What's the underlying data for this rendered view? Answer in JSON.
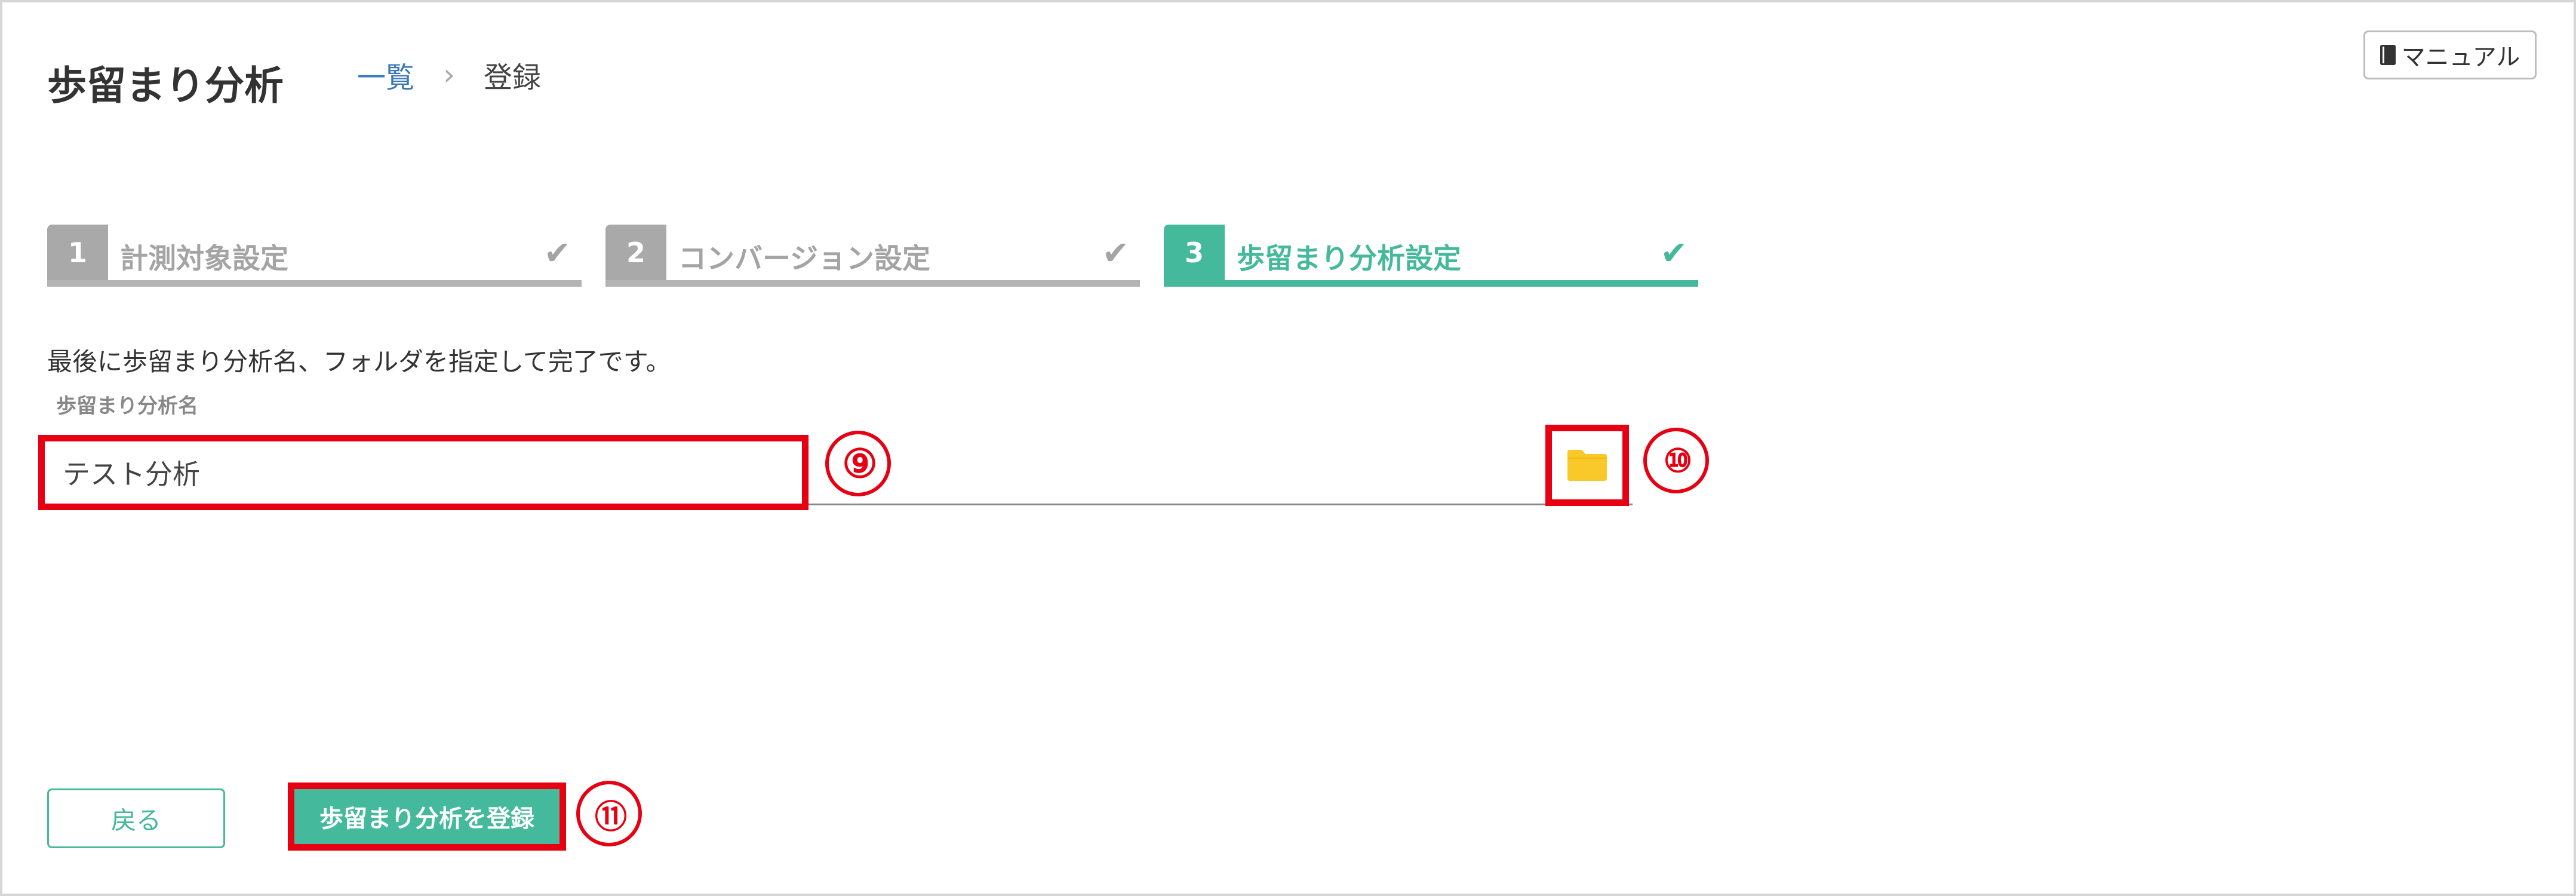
{
  "header": {
    "title": "歩留まり分析",
    "breadcrumb": {
      "link": "一覧",
      "separator": "›",
      "current": "登録"
    },
    "manual_button": {
      "label": "マニュアル",
      "icon": "book-icon"
    }
  },
  "stepper": {
    "steps": [
      {
        "number": "1",
        "label": "計測対象設定",
        "check": "✔",
        "state": "completed"
      },
      {
        "number": "2",
        "label": "コンバージョン設定",
        "check": "✔",
        "state": "completed"
      },
      {
        "number": "3",
        "label": "歩留まり分析設定",
        "check": "✔",
        "state": "active"
      }
    ]
  },
  "form": {
    "instruction": "最後に歩留まり分析名、フォルダを指定して完了です。",
    "name_label": "歩留まり分析名",
    "name_value": "テスト分析",
    "folder_icon": "folder-icon"
  },
  "annotations": {
    "marker_9": "⑨",
    "marker_10": "⑩",
    "marker_11": "⑪"
  },
  "actions": {
    "back_label": "戻る",
    "register_label": "歩留まり分析を登録"
  },
  "colors": {
    "accent": "#45b99b",
    "inactive": "#a9a9a9",
    "highlight": "#e60012",
    "folder": "#f9c92a",
    "link": "#3a78b8"
  }
}
